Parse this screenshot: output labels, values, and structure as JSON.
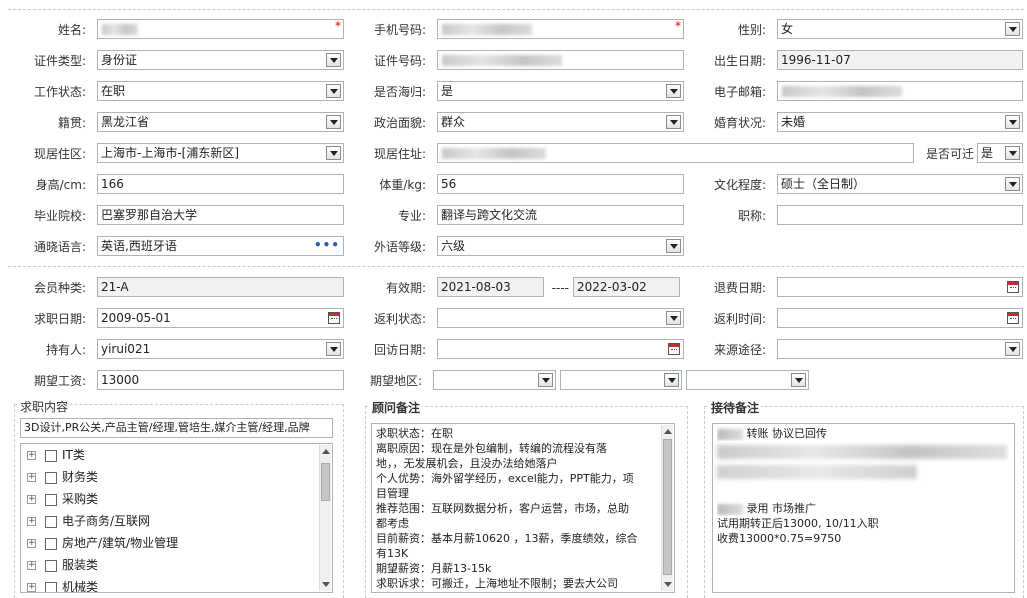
{
  "form": {
    "name": {
      "label": "姓名:",
      "value": ""
    },
    "mobile": {
      "label": "手机号码:",
      "value": ""
    },
    "gender": {
      "label": "性别:",
      "value": "女"
    },
    "id_type": {
      "label": "证件类型:",
      "value": "身份证"
    },
    "id_number": {
      "label": "证件号码:",
      "value": ""
    },
    "birth_date": {
      "label": "出生日期:",
      "value": "1996-11-07"
    },
    "work_status": {
      "label": "工作状态:",
      "value": "在职"
    },
    "returnee": {
      "label": "是否海归:",
      "value": "是"
    },
    "email": {
      "label": "电子邮箱:",
      "value": ""
    },
    "hometown": {
      "label": "籍贯:",
      "value": "黑龙江省"
    },
    "political": {
      "label": "政治面貌:",
      "value": "群众"
    },
    "marital": {
      "label": "婚育状况:",
      "value": "未婚"
    },
    "residence_area": {
      "label": "现居住区:",
      "value": "上海市-上海市-[浦东新区]"
    },
    "address": {
      "label": "现居住址:",
      "value": ""
    },
    "relocate": {
      "label": "是否可迁",
      "value": "是"
    },
    "height": {
      "label": "身高/cm:",
      "value": "166"
    },
    "weight": {
      "label": "体重/kg:",
      "value": "56"
    },
    "education": {
      "label": "文化程度:",
      "value": "硕士（全日制）"
    },
    "school": {
      "label": "毕业院校:",
      "value": "巴塞罗那自治大学"
    },
    "major": {
      "label": "专业:",
      "value": "翻译与跨文化交流"
    },
    "title": {
      "label": "职称:",
      "value": ""
    },
    "languages": {
      "label": "通晓语言:",
      "value": "英语,西班牙语"
    },
    "foreign_level": {
      "label": "外语等级:",
      "value": "六级"
    }
  },
  "member": {
    "type": {
      "label": "会员种类:",
      "value": "21-A"
    },
    "validity": {
      "label": "有效期:",
      "from": "2021-08-03",
      "sep": "----",
      "to": "2022-03-02"
    },
    "refund_date": {
      "label": "退费日期:",
      "value": ""
    },
    "apply_date": {
      "label": "求职日期:",
      "value": "2009-05-01"
    },
    "rebate_status": {
      "label": "返利状态:",
      "value": ""
    },
    "rebate_time": {
      "label": "返利时间:",
      "value": ""
    },
    "holder": {
      "label": "持有人:",
      "value": "yirui021"
    },
    "visit_date": {
      "label": "回访日期:",
      "value": ""
    },
    "source": {
      "label": "来源途径:",
      "value": ""
    },
    "expected_salary": {
      "label": "期望工资:",
      "value": "13000"
    },
    "expected_region": {
      "label": "期望地区:",
      "values": [
        "",
        "",
        ""
      ]
    }
  },
  "job_panel": {
    "title": "求职内容",
    "summary": "3D设计,PR公关,产品主管/经理,管培生,媒介主管/经理,品牌",
    "categories": [
      "IT类",
      "财务类",
      "采购类",
      "电子商务/互联网",
      "房地产/建筑/物业管理",
      "服装类",
      "机械类"
    ]
  },
  "consultant_panel": {
    "title": "顾问备注",
    "lines": [
      "求职状态：在职",
      "离职原因：现在是外包编制，转编的流程没有落",
      "地，，无发展机会，且没办法给她落户",
      "个人优势：海外留学经历，excel能力，PPT能力，项",
      "目管理",
      "推荐范围：互联网数据分析，客户运营，市场，总助",
      "都考虑",
      "目前薪资：基本月薪10620 ，13薪，季度绩效，综合",
      "有13K",
      "期望薪资：月薪13-15k",
      "求职诉求：可搬迁，上海地址不限制；要去大公司"
    ]
  },
  "reception_panel": {
    "title": "接待备注",
    "line1": "转账 协议已回传",
    "line2": "录用  市场推广",
    "line3": "试用期转正后13000, 10/11入职",
    "line4": "收费13000*0.75=9750"
  },
  "colors": {
    "border": "#a9b4c0",
    "readonly_bg": "#f2f2f2",
    "required": "#d00000"
  }
}
